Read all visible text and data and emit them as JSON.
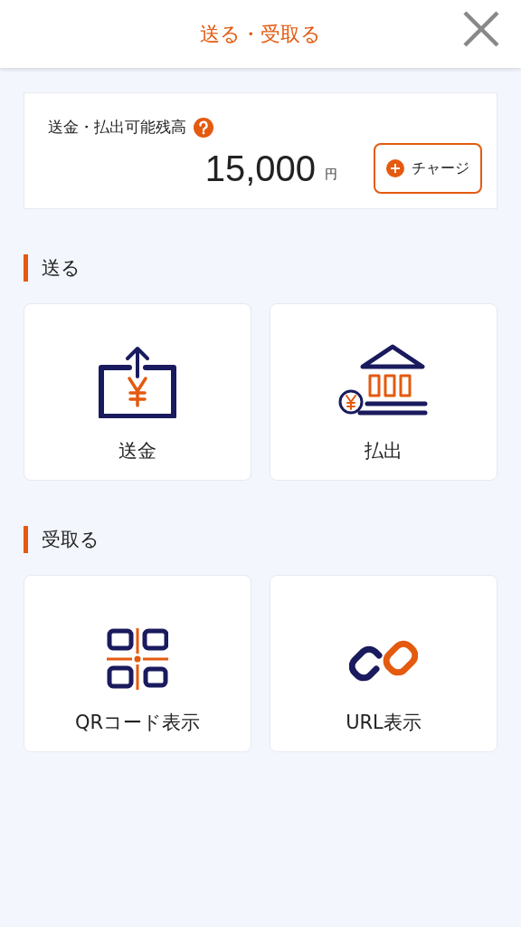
{
  "header": {
    "title": "送る・受取る"
  },
  "balance": {
    "label": "送金・払出可能残高",
    "amount": "15,000",
    "unit": "円",
    "charge_button": "チャージ"
  },
  "sections": [
    {
      "title": "送る",
      "tiles": [
        {
          "kind": "send",
          "label": "送金"
        },
        {
          "kind": "bank",
          "label": "払出"
        }
      ]
    },
    {
      "title": "受取る",
      "tiles": [
        {
          "kind": "qr",
          "label": "QRコード表示"
        },
        {
          "kind": "link",
          "label": "URL表示"
        }
      ]
    }
  ]
}
